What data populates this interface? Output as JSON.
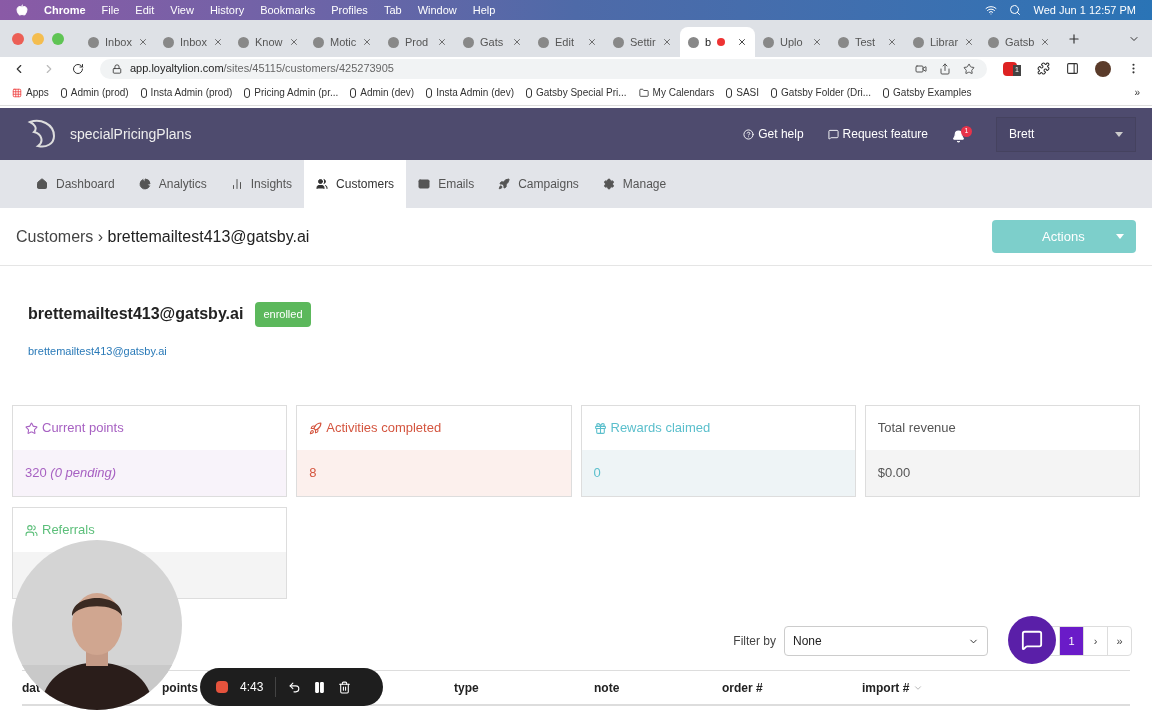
{
  "menubar": {
    "app": "Chrome",
    "menus": [
      "File",
      "Edit",
      "View",
      "History",
      "Bookmarks",
      "Profiles",
      "Tab",
      "Window",
      "Help"
    ],
    "clock": "Wed Jun 1  12:57 PM"
  },
  "tabs": [
    {
      "title": "Inbox",
      "selected": false
    },
    {
      "title": "Inbox",
      "selected": false
    },
    {
      "title": "Know",
      "selected": false
    },
    {
      "title": "Motic",
      "selected": false
    },
    {
      "title": "Prod",
      "selected": false
    },
    {
      "title": "Gats",
      "selected": false
    },
    {
      "title": "Edit",
      "selected": false
    },
    {
      "title": "Settir",
      "selected": false
    },
    {
      "title": "b",
      "selected": true
    },
    {
      "title": "Uplo",
      "selected": false
    },
    {
      "title": "Test",
      "selected": false
    },
    {
      "title": "Librar",
      "selected": false
    },
    {
      "title": "Gatsb",
      "selected": false
    }
  ],
  "address": {
    "host": "app.loyaltylion.com",
    "path": "/sites/45115/customers/425273905",
    "extension_badge": "1"
  },
  "bookmarks": [
    "Apps",
    "Admin (prod)",
    "Insta Admin (prod)",
    "Pricing Admin (pr...",
    "Admin (dev)",
    "Insta Admin (dev)",
    "Gatsby Special Pri...",
    "My Calendars",
    "SASI",
    "Gatsby Folder (Dri...",
    "Gatsby Examples"
  ],
  "bookmarks_more": "»",
  "header": {
    "brand": "specialPricingPlans",
    "links": [
      "Get help",
      "Request feature"
    ],
    "notifications": "1",
    "user": "Brett"
  },
  "nav": [
    {
      "label": "Dashboard",
      "selected": false
    },
    {
      "label": "Analytics",
      "selected": false
    },
    {
      "label": "Insights",
      "selected": false
    },
    {
      "label": "Customers",
      "selected": true
    },
    {
      "label": "Emails",
      "selected": false
    },
    {
      "label": "Campaigns",
      "selected": false
    },
    {
      "label": "Manage",
      "selected": false
    }
  ],
  "breadcrumb": {
    "parent": "Customers",
    "separator": "›",
    "current": "brettemailtest413@gatsby.ai"
  },
  "actions_button": "Actions",
  "customer": {
    "name": "brettemailtest413@gatsby.ai",
    "status": "enrolled",
    "email": "brettemailtest413@gatsby.ai"
  },
  "stats": [
    {
      "kind": "points",
      "label": "Current points",
      "value": "320",
      "note": "(0 pending)",
      "color": "#a761c2"
    },
    {
      "kind": "activities",
      "label": "Activities completed",
      "value": "8",
      "color": "#d4553f"
    },
    {
      "kind": "rewards",
      "label": "Rewards claimed",
      "value": "0",
      "color": "#5bbfcc"
    },
    {
      "kind": "revenue",
      "label": "Total revenue",
      "value": "$0.00",
      "color": "#555555"
    },
    {
      "kind": "referrals",
      "label": "Referrals",
      "color": "#5cbf7a"
    }
  ],
  "filter": {
    "label": "Filter by",
    "value": "None"
  },
  "pagination": [
    {
      "label": "1",
      "selected": true
    },
    {
      "label": "›",
      "selected": false
    },
    {
      "label": "»",
      "selected": false
    }
  ],
  "table": {
    "columns": [
      "dat",
      "points",
      "type",
      "note",
      "order #",
      "import #"
    ]
  },
  "recorder": {
    "time": "4:43"
  }
}
